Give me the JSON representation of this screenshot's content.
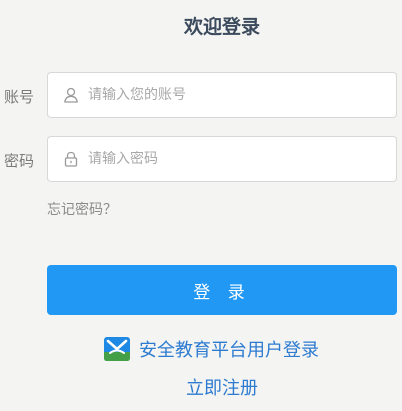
{
  "page": {
    "title": "欢迎登录"
  },
  "account": {
    "label": "账号",
    "placeholder": "请输入您的账号",
    "value": ""
  },
  "password": {
    "label": "密码",
    "placeholder": "请输入密码",
    "value": ""
  },
  "forgot": {
    "label": "忘记密码？"
  },
  "login_button": {
    "label": "登 录"
  },
  "platform_login": {
    "label": "安全教育平台用户登录",
    "icon": "education-platform-logo-icon"
  },
  "register": {
    "label": "立即注册"
  },
  "colors": {
    "background": "#f4f4f2",
    "primary": "#2198f3",
    "link": "#2d7bd1",
    "title": "#3b4a5c"
  }
}
